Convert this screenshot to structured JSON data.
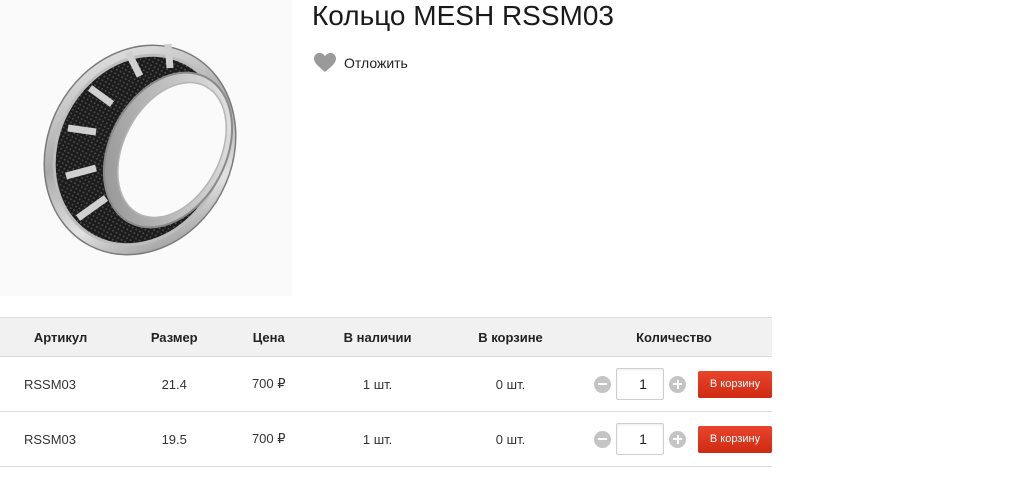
{
  "product": {
    "title": "Кольцо MESH RSSM03",
    "wishlist_label": "Отложить",
    "image_alt": "ring-photo"
  },
  "table": {
    "headers": {
      "sku": "Артикул",
      "size": "Размер",
      "price": "Цена",
      "stock": "В наличии",
      "in_cart": "В корзине",
      "quantity": "Количество"
    },
    "rows": [
      {
        "sku": "RSSM03",
        "size": "21.4",
        "price": "700 ₽",
        "stock": "1 шт.",
        "in_cart": "0 шт.",
        "qty": "1",
        "button": "В корзину"
      },
      {
        "sku": "RSSM03",
        "size": "19.5",
        "price": "700 ₽",
        "stock": "1 шт.",
        "in_cart": "0 шт.",
        "qty": "1",
        "button": "В корзину"
      }
    ]
  },
  "colors": {
    "accent": "#d9331a",
    "header_bg": "#f1f1f1",
    "icon_gray": "#9a9a9a"
  }
}
